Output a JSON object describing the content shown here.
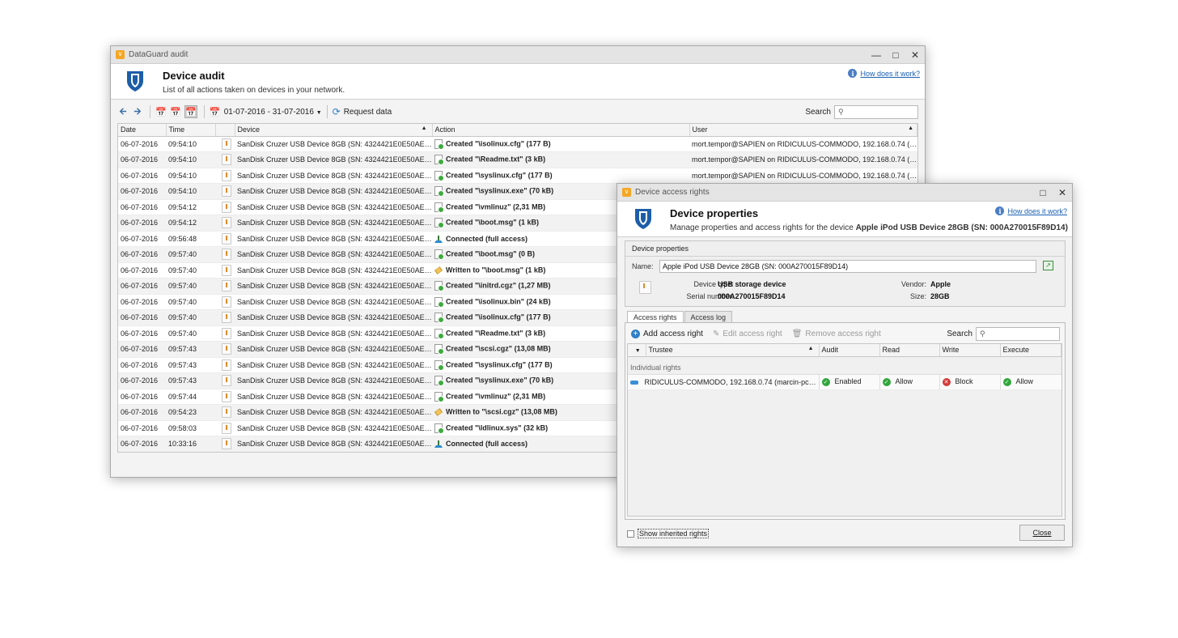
{
  "audit_window": {
    "title": "DataGuard audit",
    "header_title": "Device audit",
    "header_subtitle": "List of all actions taken on devices in your network.",
    "help_link": "How does it work?",
    "toolbar": {
      "date_range": "01-07-2016 - 31-07-2016",
      "request_label": "Request data",
      "search_label": "Search"
    },
    "columns": [
      "Date",
      "Time",
      "",
      "Device",
      "Action",
      "User"
    ],
    "rows": [
      {
        "date": "06-07-2016",
        "time": "09:54:10",
        "device": "SanDisk Cruzer USB Device 8GB (SN: 4324421E0E50AEC7)",
        "action_type": "created",
        "action": "Created \"\\isolinux.cfg\" (177 B)",
        "user": "mort.tempor@SAPIEN on RIDICULUS-COMMODO, 192.168.0.74 (marci..."
      },
      {
        "date": "06-07-2016",
        "time": "09:54:10",
        "device": "SanDisk Cruzer USB Device 8GB (SN: 4324421E0E50AEC7)",
        "action_type": "created",
        "action": "Created \"\\Readme.txt\" (3 kB)",
        "user": "mort.tempor@SAPIEN on RIDICULUS-COMMODO, 192.168.0.74 (marci..."
      },
      {
        "date": "06-07-2016",
        "time": "09:54:10",
        "device": "SanDisk Cruzer USB Device 8GB (SN: 4324421E0E50AEC7)",
        "action_type": "created",
        "action": "Created \"\\syslinux.cfg\" (177 B)",
        "user": "mort.tempor@SAPIEN on RIDICULUS-COMMODO, 192.168.0.74 (marci..."
      },
      {
        "date": "06-07-2016",
        "time": "09:54:10",
        "device": "SanDisk Cruzer USB Device 8GB (SN: 4324421E0E50AEC7)",
        "action_type": "created",
        "action": "Created \"\\syslinux.exe\" (70 kB)",
        "user": ""
      },
      {
        "date": "06-07-2016",
        "time": "09:54:12",
        "device": "SanDisk Cruzer USB Device 8GB (SN: 4324421E0E50AEC7)",
        "action_type": "created",
        "action": "Created \"\\vmlinuz\" (2,31 MB)",
        "user": ""
      },
      {
        "date": "06-07-2016",
        "time": "09:54:12",
        "device": "SanDisk Cruzer USB Device 8GB (SN: 4324421E0E50AEC7)",
        "action_type": "created",
        "action": "Created \"\\boot.msg\" (1 kB)",
        "user": ""
      },
      {
        "date": "06-07-2016",
        "time": "09:56:48",
        "device": "SanDisk Cruzer USB Device 8GB (SN: 4324421E0E50AEC7)",
        "action_type": "connected",
        "action": "Connected (full access)",
        "user": ""
      },
      {
        "date": "06-07-2016",
        "time": "09:57:40",
        "device": "SanDisk Cruzer USB Device 8GB (SN: 4324421E0E50AEC7)",
        "action_type": "created",
        "action": "Created \"\\boot.msg\" (0 B)",
        "user": ""
      },
      {
        "date": "06-07-2016",
        "time": "09:57:40",
        "device": "SanDisk Cruzer USB Device 8GB (SN: 4324421E0E50AEC7)",
        "action_type": "written",
        "action": "Written to \"\\boot.msg\" (1 kB)",
        "user": ""
      },
      {
        "date": "06-07-2016",
        "time": "09:57:40",
        "device": "SanDisk Cruzer USB Device 8GB (SN: 4324421E0E50AEC7)",
        "action_type": "created",
        "action": "Created \"\\initrd.cgz\" (1,27 MB)",
        "user": ""
      },
      {
        "date": "06-07-2016",
        "time": "09:57:40",
        "device": "SanDisk Cruzer USB Device 8GB (SN: 4324421E0E50AEC7)",
        "action_type": "created",
        "action": "Created \"\\isolinux.bin\" (24 kB)",
        "user": ""
      },
      {
        "date": "06-07-2016",
        "time": "09:57:40",
        "device": "SanDisk Cruzer USB Device 8GB (SN: 4324421E0E50AEC7)",
        "action_type": "created",
        "action": "Created \"\\isolinux.cfg\" (177 B)",
        "user": ""
      },
      {
        "date": "06-07-2016",
        "time": "09:57:40",
        "device": "SanDisk Cruzer USB Device 8GB (SN: 4324421E0E50AEC7)",
        "action_type": "created",
        "action": "Created \"\\Readme.txt\" (3 kB)",
        "user": ""
      },
      {
        "date": "06-07-2016",
        "time": "09:57:43",
        "device": "SanDisk Cruzer USB Device 8GB (SN: 4324421E0E50AEC7)",
        "action_type": "created",
        "action": "Created \"\\scsi.cgz\" (13,08 MB)",
        "user": ""
      },
      {
        "date": "06-07-2016",
        "time": "09:57:43",
        "device": "SanDisk Cruzer USB Device 8GB (SN: 4324421E0E50AEC7)",
        "action_type": "created",
        "action": "Created \"\\syslinux.cfg\" (177 B)",
        "user": ""
      },
      {
        "date": "06-07-2016",
        "time": "09:57:43",
        "device": "SanDisk Cruzer USB Device 8GB (SN: 4324421E0E50AEC7)",
        "action_type": "created",
        "action": "Created \"\\syslinux.exe\" (70 kB)",
        "user": ""
      },
      {
        "date": "06-07-2016",
        "time": "09:57:44",
        "device": "SanDisk Cruzer USB Device 8GB (SN: 4324421E0E50AEC7)",
        "action_type": "created",
        "action": "Created \"\\vmlinuz\" (2,31 MB)",
        "user": ""
      },
      {
        "date": "06-07-2016",
        "time": "09:54:23",
        "device": "SanDisk Cruzer USB Device 8GB (SN: 4324421E0E50AEC7)",
        "action_type": "written",
        "action": "Written to \"\\scsi.cgz\" (13,08 MB)",
        "user": ""
      },
      {
        "date": "06-07-2016",
        "time": "09:58:03",
        "device": "SanDisk Cruzer USB Device 8GB (SN: 4324421E0E50AEC7)",
        "action_type": "created",
        "action": "Created \"\\ldlinux.sys\" (32 kB)",
        "user": ""
      },
      {
        "date": "06-07-2016",
        "time": "10:33:16",
        "device": "SanDisk Cruzer USB Device 8GB (SN: 4324421E0E50AEC7)",
        "action_type": "connected",
        "action": "Connected (full access)",
        "user": ""
      }
    ]
  },
  "rights_window": {
    "title": "Device access rights",
    "header_title": "Device properties",
    "header_subtitle_prefix": "Manage properties and access rights for the device ",
    "header_subtitle_device": "Apple iPod USB Device 28GB (SN: 000A270015F89D14)",
    "help_link": "How does it work?",
    "group_title": "Device properties",
    "name_label": "Name:",
    "name_value": "Apple iPod USB Device 28GB (SN: 000A270015F89D14)",
    "device_type_label": "Device type:",
    "device_type_value": "USB storage device",
    "serial_label": "Serial number:",
    "serial_value": "000A270015F89D14",
    "vendor_label": "Vendor:",
    "vendor_value": "Apple",
    "size_label": "Size:",
    "size_value": "28GB",
    "tabs": [
      "Access rights",
      "Access log"
    ],
    "add_label": "Add access right",
    "edit_label": "Edit access right",
    "remove_label": "Remove access right",
    "search_label": "Search",
    "columns": [
      "Trustee",
      "Audit",
      "Read",
      "Write",
      "Execute"
    ],
    "group_row": "Individual rights",
    "rights_row": {
      "trustee": "RIDICULUS-COMMODO, 192.168.0.74 (marcin-pcc.axen...",
      "audit": "Enabled",
      "read": "Allow",
      "write": "Block",
      "execute": "Allow"
    },
    "show_inherited_label": "Show inherited rights",
    "close_label": "Close"
  },
  "colors": {
    "accent": "#1a5fb4",
    "allow": "#31a63c",
    "block": "#d13b3b",
    "brand_shield": "#1d5ea8"
  }
}
